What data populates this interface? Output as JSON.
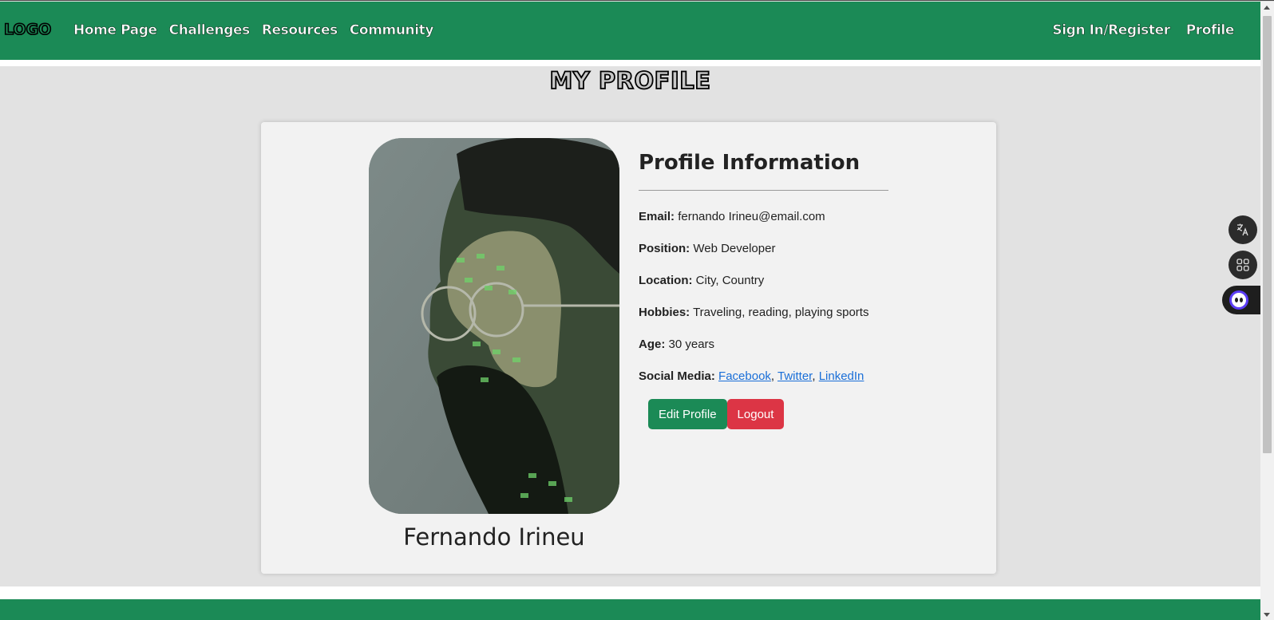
{
  "nav": {
    "logo": "LOGO",
    "left_links": [
      "Home Page",
      "Challenges",
      "Resources",
      "Community"
    ],
    "right_links": [
      "Sign In/Register",
      "Profile"
    ]
  },
  "page_title": "MY PROFILE",
  "profile": {
    "name": "Fernando Irineu",
    "heading": "Profile Information",
    "email_label": "Email:",
    "email": "fernando Irineu@email.com",
    "position_label": "Position:",
    "position": "Web Developer",
    "location_label": "Location:",
    "location": "City, Country",
    "hobbies_label": "Hobbies:",
    "hobbies": "Traveling, reading, playing sports",
    "age_label": "Age:",
    "age": "30 years",
    "social_label": "Social Media:",
    "social": [
      "Facebook",
      "Twitter",
      "LinkedIn"
    ],
    "separator": ","
  },
  "buttons": {
    "edit": "Edit Profile",
    "logout": "Logout"
  },
  "colors": {
    "brand_green": "#1b8a56",
    "danger": "#dc3545",
    "link": "#1a6fd8"
  },
  "widgets": [
    "translate-icon",
    "apps-grid-icon",
    "assistant-bot-icon"
  ]
}
